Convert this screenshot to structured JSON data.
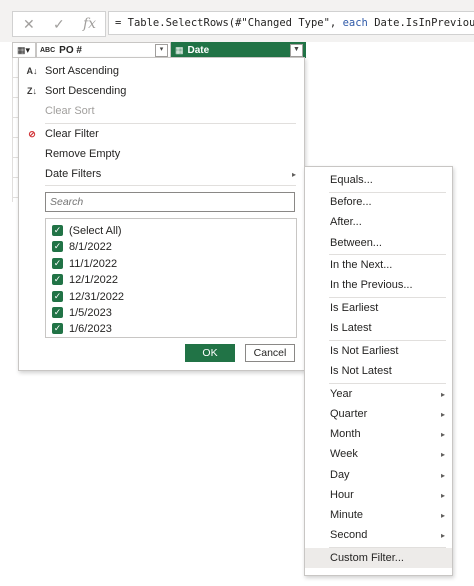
{
  "formula": {
    "cancel_icon": "close-icon",
    "confirm_icon": "check-icon",
    "fx_label": "fx",
    "prefix": "= Table.SelectRows(#\"Changed Type\", ",
    "keyword": "each",
    "rest": " Date.IsInPreviousYear([D"
  },
  "columns": {
    "po_label": "PO #",
    "date_label": "Date",
    "po_type_icon": "ABC",
    "date_type_icon": "calendar-icon"
  },
  "dropdown": {
    "sort_ascending": "Sort Ascending",
    "sort_descending": "Sort Descending",
    "clear_sort": "Clear Sort",
    "clear_filter": "Clear Filter",
    "remove_empty": "Remove Empty",
    "date_filters": "Date Filters",
    "search_placeholder": "Search",
    "values": [
      "(Select All)",
      "8/1/2022",
      "11/1/2022",
      "12/1/2022",
      "12/31/2022",
      "1/5/2023",
      "1/6/2023"
    ],
    "ok_label": "OK",
    "cancel_label": "Cancel"
  },
  "date_filters_menu": {
    "items": [
      "Equals...",
      "Before...",
      "After...",
      "Between...",
      "In the Next...",
      "In the Previous...",
      "Is Earliest",
      "Is Latest",
      "Is Not Earliest",
      "Is Not Latest",
      "Year",
      "Quarter",
      "Month",
      "Week",
      "Day",
      "Hour",
      "Minute",
      "Second",
      "Custom Filter..."
    ]
  },
  "colors": {
    "accent": "#217346",
    "hover": "#edebe9"
  }
}
